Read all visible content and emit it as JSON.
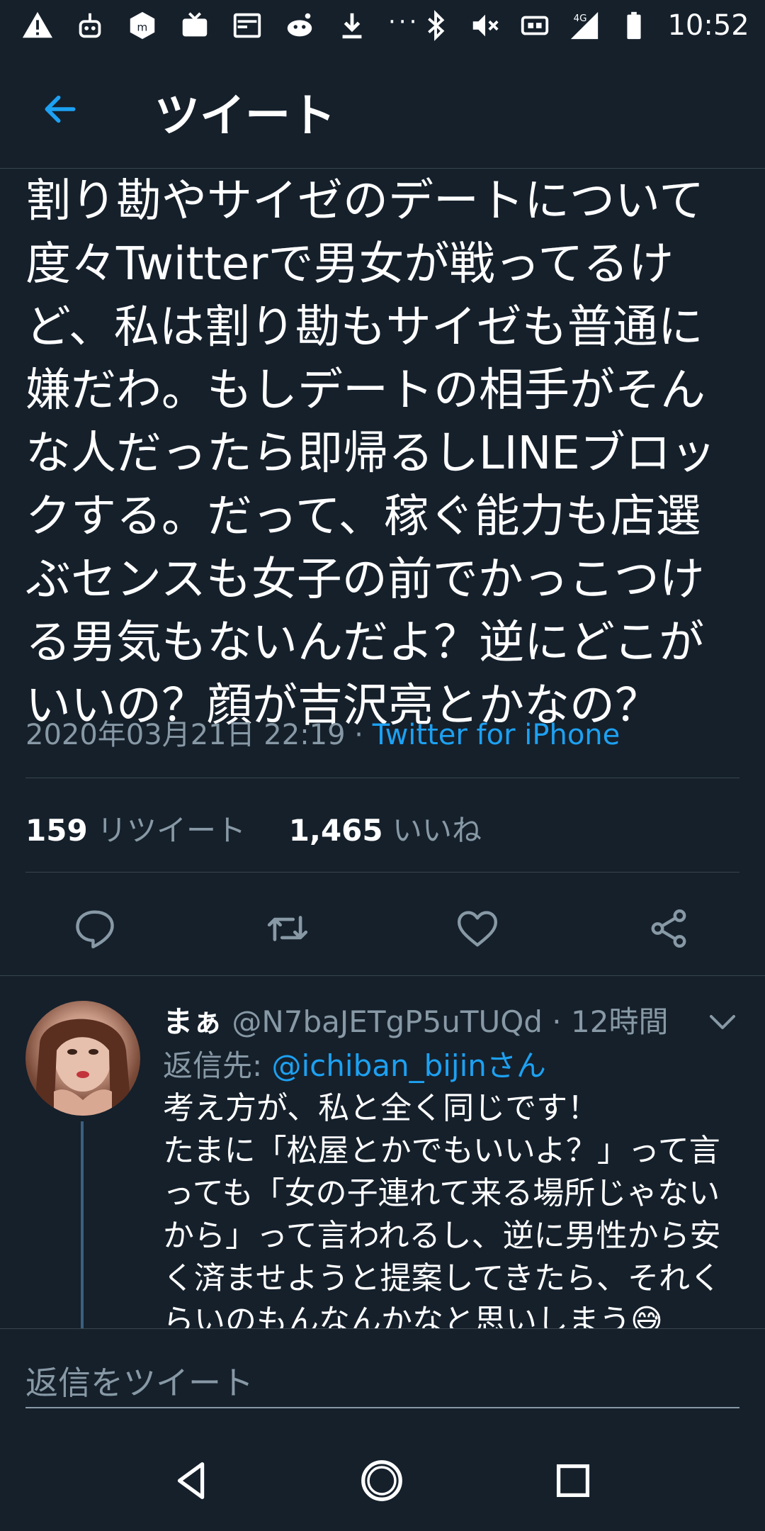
{
  "status_bar": {
    "time": "10:52",
    "network": "4G",
    "icons": [
      "warning-icon",
      "robot-app-icon",
      "box-app-icon",
      "tv-icon",
      "cast-icon",
      "reddit-icon",
      "download-icon",
      "more-dots-icon",
      "bluetooth-icon",
      "mute-icon",
      "vibrate-icon",
      "signal-icon",
      "battery-icon"
    ],
    "dots": "···"
  },
  "header": {
    "title": "ツイート"
  },
  "tweet": {
    "text": "割り勘やサイゼのデートについて度々Twitterで男女が戦ってるけど、私は割り勘もサイゼも普通に嫌だわ。もしデートの相手がそんな人だったら即帰るしLINEブロックする。だって、稼ぐ能力も店選ぶセンスも女子の前でかっこつける男気もないんだよ？逆にどこがいいの？顔が吉沢亮とかなの？",
    "date": "2020年03月21日 22:19",
    "separator": " · ",
    "source": "Twitter for iPhone",
    "retweets_count": "159",
    "retweets_label": "リツイート",
    "likes_count": "1,465",
    "likes_label": "いいね"
  },
  "reply": {
    "name": "まぁ",
    "handle": "@N7baJETgP5uTUQd",
    "time": "12時間",
    "time_separator": " · ",
    "reply_to_label": "返信先: ",
    "reply_to_user": "@ichiban_bijinさん",
    "text": "考え方が、私と全く同じです！\nたまに「松屋とかでもいいよ？」って言っても「女の子連れて来る場所じゃないから」って言われるし、逆に男性から安く済ませようと提案してきたら、それくらいのもんなんかなと思いしまう😅"
  },
  "compose": {
    "placeholder": "返信をツイート"
  },
  "colors": {
    "background": "#15202b",
    "accent": "#1da1f2",
    "secondary_text": "#8899a6",
    "divider": "#38444d"
  }
}
